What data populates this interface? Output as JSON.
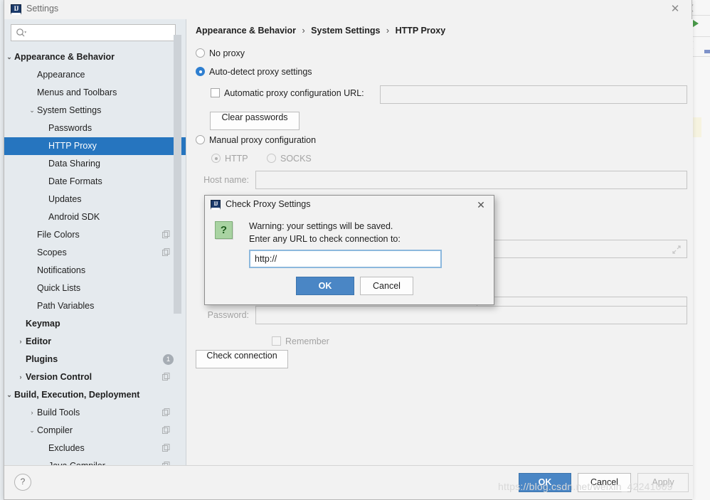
{
  "window": {
    "title": "Settings",
    "app_icon": "intellij-idea-icon",
    "close_label": "✕"
  },
  "search": {
    "value": "",
    "placeholder": "",
    "icon": "search-icon"
  },
  "sidebar": {
    "items": [
      {
        "label": "Appearance & Behavior",
        "indent": 14,
        "arrow": "⌄",
        "bold": true,
        "selected": false,
        "copy": false,
        "badge": ""
      },
      {
        "label": "Appearance",
        "indent": 46,
        "arrow": "",
        "bold": false,
        "selected": false,
        "copy": false,
        "badge": ""
      },
      {
        "label": "Menus and Toolbars",
        "indent": 46,
        "arrow": "",
        "bold": false,
        "selected": false,
        "copy": false,
        "badge": ""
      },
      {
        "label": "System Settings",
        "indent": 46,
        "arrow": "⌄",
        "bold": false,
        "selected": false,
        "copy": false,
        "badge": ""
      },
      {
        "label": "Passwords",
        "indent": 62,
        "arrow": "",
        "bold": false,
        "selected": false,
        "copy": false,
        "badge": ""
      },
      {
        "label": "HTTP Proxy",
        "indent": 62,
        "arrow": "",
        "bold": false,
        "selected": true,
        "copy": false,
        "badge": ""
      },
      {
        "label": "Data Sharing",
        "indent": 62,
        "arrow": "",
        "bold": false,
        "selected": false,
        "copy": false,
        "badge": ""
      },
      {
        "label": "Date Formats",
        "indent": 62,
        "arrow": "",
        "bold": false,
        "selected": false,
        "copy": false,
        "badge": ""
      },
      {
        "label": "Updates",
        "indent": 62,
        "arrow": "",
        "bold": false,
        "selected": false,
        "copy": false,
        "badge": ""
      },
      {
        "label": "Android SDK",
        "indent": 62,
        "arrow": "",
        "bold": false,
        "selected": false,
        "copy": false,
        "badge": ""
      },
      {
        "label": "File Colors",
        "indent": 46,
        "arrow": "",
        "bold": false,
        "selected": false,
        "copy": true,
        "badge": ""
      },
      {
        "label": "Scopes",
        "indent": 46,
        "arrow": "",
        "bold": false,
        "selected": false,
        "copy": true,
        "badge": ""
      },
      {
        "label": "Notifications",
        "indent": 46,
        "arrow": "",
        "bold": false,
        "selected": false,
        "copy": false,
        "badge": ""
      },
      {
        "label": "Quick Lists",
        "indent": 46,
        "arrow": "",
        "bold": false,
        "selected": false,
        "copy": false,
        "badge": ""
      },
      {
        "label": "Path Variables",
        "indent": 46,
        "arrow": "",
        "bold": false,
        "selected": false,
        "copy": false,
        "badge": ""
      },
      {
        "label": "Keymap",
        "indent": 30,
        "arrow": "",
        "bold": true,
        "selected": false,
        "copy": false,
        "badge": ""
      },
      {
        "label": "Editor",
        "indent": 30,
        "arrow": "›",
        "bold": true,
        "selected": false,
        "copy": false,
        "badge": ""
      },
      {
        "label": "Plugins",
        "indent": 30,
        "arrow": "",
        "bold": true,
        "selected": false,
        "copy": false,
        "badge": "1"
      },
      {
        "label": "Version Control",
        "indent": 30,
        "arrow": "›",
        "bold": true,
        "selected": false,
        "copy": true,
        "badge": ""
      },
      {
        "label": "Build, Execution, Deployment",
        "indent": 14,
        "arrow": "⌄",
        "bold": true,
        "selected": false,
        "copy": false,
        "badge": ""
      },
      {
        "label": "Build Tools",
        "indent": 46,
        "arrow": "›",
        "bold": false,
        "selected": false,
        "copy": true,
        "badge": ""
      },
      {
        "label": "Compiler",
        "indent": 46,
        "arrow": "⌄",
        "bold": false,
        "selected": false,
        "copy": true,
        "badge": ""
      },
      {
        "label": "Excludes",
        "indent": 62,
        "arrow": "",
        "bold": false,
        "selected": false,
        "copy": true,
        "badge": ""
      },
      {
        "label": "Java Compiler",
        "indent": 62,
        "arrow": "",
        "bold": false,
        "selected": false,
        "copy": true,
        "badge": ""
      }
    ]
  },
  "main": {
    "breadcrumb": {
      "part1": "Appearance & Behavior",
      "sep1": "›",
      "part2": "System Settings",
      "sep2": "›",
      "part3": "HTTP Proxy"
    },
    "no_proxy_label": "No proxy",
    "auto_detect_label": "Auto-detect proxy settings",
    "auto_config_url_label": "Automatic proxy configuration URL:",
    "auto_config_url_value": "",
    "clear_passwords_label": "Clear passwords",
    "manual_proxy_label": "Manual proxy configuration",
    "http_label": "HTTP",
    "socks_label": "SOCKS",
    "host_name_label": "Host name:",
    "host_name_value": "",
    "no_proxy_for_value": "",
    "login_value": "",
    "password_label": "Password:",
    "password_value": "",
    "remember_label": "Remember",
    "check_connection_label": "Check connection"
  },
  "dialog": {
    "icon": "intellij-idea-icon",
    "title": "Check Proxy Settings",
    "close_label": "✕",
    "question_icon": "?",
    "message_line1": "Warning: your settings will be saved.",
    "message_line2": "Enter any URL to check connection to:",
    "url_value": "http://",
    "url_placeholder": "",
    "ok_label": "OK",
    "cancel_label": "Cancel"
  },
  "bottom_bar": {
    "help_label": "?",
    "ok_label": "OK",
    "cancel_label": "Cancel",
    "apply_label": "Apply"
  },
  "watermark": {
    "text": "https://blog.csdn.net/weixin_42241009"
  },
  "colors": {
    "accent_blue": "#2675bf",
    "button_blue": "#4a86c5",
    "sidebar_bg": "#e5eaee",
    "panel_bg": "#f2f2f2",
    "focus_border": "#8cb8dd",
    "question_green": "#a9d3a2"
  }
}
